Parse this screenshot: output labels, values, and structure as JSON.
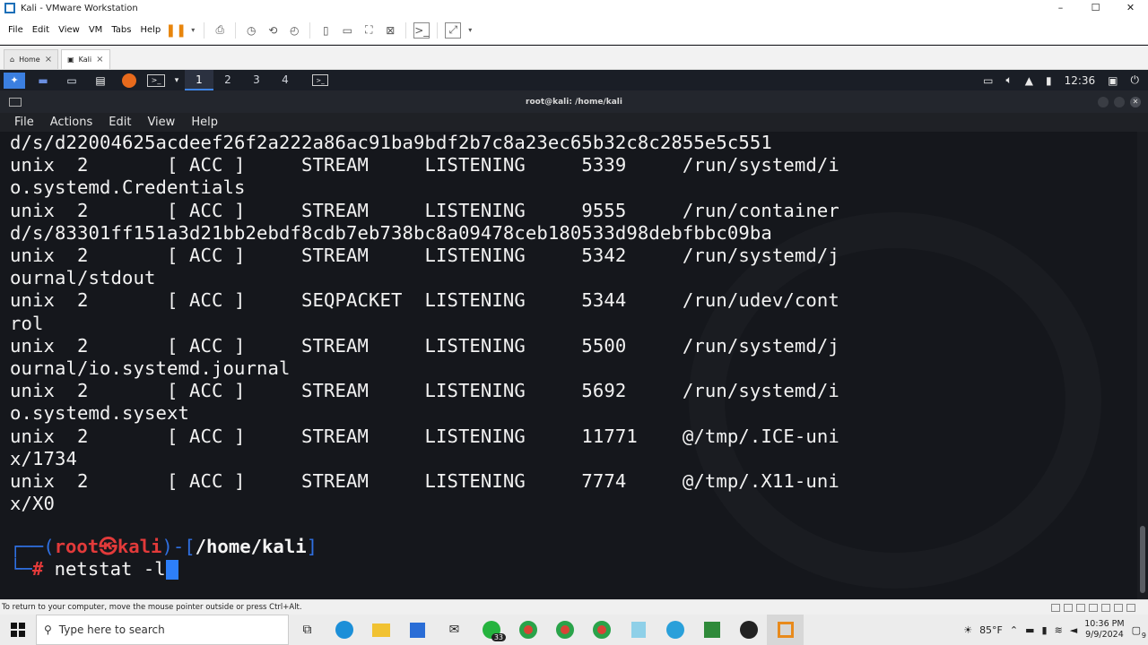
{
  "window": {
    "title": "Kali - VMware Workstation",
    "controls": [
      "–",
      "☐",
      "✕"
    ]
  },
  "vm_menu": [
    "File",
    "Edit",
    "View",
    "VM",
    "Tabs",
    "Help"
  ],
  "vm_tabs": [
    {
      "label": "Home",
      "active": false
    },
    {
      "label": "Kali",
      "active": true
    }
  ],
  "kali_panel": {
    "workspaces": [
      "1",
      "2",
      "3",
      "4"
    ],
    "active_workspace": "1",
    "time": "12:36"
  },
  "terminal": {
    "title": "root@kali: /home/kali",
    "menu": [
      "File",
      "Actions",
      "Edit",
      "View",
      "Help"
    ],
    "lines": [
      "d/s/d22004625acdeef26f2a222a86ac91ba9bdf2b7c8a23ec65b32c8c2855e5c551",
      "unix  2       [ ACC ]     STREAM     LISTENING     5339     /run/systemd/i",
      "o.systemd.Credentials",
      "unix  2       [ ACC ]     STREAM     LISTENING     9555     /run/container",
      "d/s/83301ff151a3d21bb2ebdf8cdb7eb738bc8a09478ceb180533d98debfbbc09ba",
      "unix  2       [ ACC ]     STREAM     LISTENING     5342     /run/systemd/j",
      "ournal/stdout",
      "unix  2       [ ACC ]     SEQPACKET  LISTENING     5344     /run/udev/cont",
      "rol",
      "unix  2       [ ACC ]     STREAM     LISTENING     5500     /run/systemd/j",
      "ournal/io.systemd.journal",
      "unix  2       [ ACC ]     STREAM     LISTENING     5692     /run/systemd/i",
      "o.systemd.sysext",
      "unix  2       [ ACC ]     STREAM     LISTENING     11771    @/tmp/.ICE-uni",
      "x/1734",
      "unix  2       [ ACC ]     STREAM     LISTENING     7774     @/tmp/.X11-uni",
      "x/X0"
    ],
    "prompt": {
      "corner_top": "┌──(",
      "user": "root",
      "at": "㉿",
      "host": "kali",
      "sep": ")-[",
      "path": "/home/kali",
      "close": "]",
      "corner_bottom": "└─",
      "hash": "#",
      "command": "netstat -l"
    }
  },
  "vm_status": {
    "hint": "To return to your computer, move the mouse pointer outside or press Ctrl+Alt."
  },
  "taskbar": {
    "search_placeholder": "Type here to search",
    "whatsapp_badge": "33",
    "weather": "85°F",
    "time": "10:36 PM",
    "date": "9/9/2024",
    "notifications": "9"
  },
  "colors": {
    "terminal_bg": "#15171c",
    "prompt_blue": "#2f6fe0",
    "prompt_red": "#e23a3a",
    "cursor": "#2d7ff9",
    "vmware_pause": "#e8850c"
  }
}
